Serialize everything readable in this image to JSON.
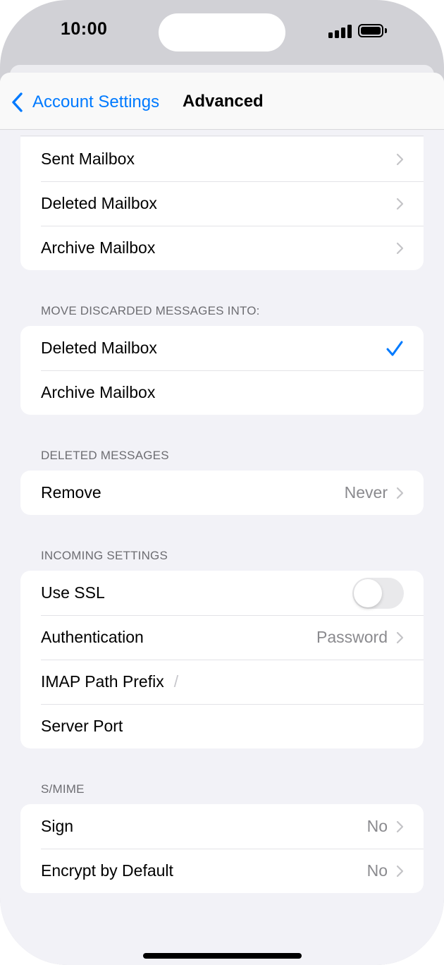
{
  "status_bar": {
    "time": "10:00"
  },
  "nav": {
    "back_label": "Account Settings",
    "title": "Advanced"
  },
  "mailbox_group": [
    {
      "label": "Sent Mailbox"
    },
    {
      "label": "Deleted Mailbox"
    },
    {
      "label": "Archive Mailbox"
    }
  ],
  "discard": {
    "header": "MOVE DISCARDED MESSAGES INTO:",
    "options": [
      {
        "label": "Deleted Mailbox",
        "selected": true
      },
      {
        "label": "Archive Mailbox",
        "selected": false
      }
    ]
  },
  "deleted_messages": {
    "header": "DELETED MESSAGES",
    "remove": {
      "label": "Remove",
      "value": "Never"
    }
  },
  "incoming": {
    "header": "INCOMING SETTINGS",
    "use_ssl": {
      "label": "Use SSL",
      "on": false
    },
    "authentication": {
      "label": "Authentication",
      "value": "Password"
    },
    "imap_prefix": {
      "label": "IMAP Path Prefix",
      "value": "/"
    },
    "server_port": {
      "label": "Server Port",
      "value": ""
    }
  },
  "smime": {
    "header": "S/MIME",
    "sign": {
      "label": "Sign",
      "value": "No"
    },
    "encrypt": {
      "label": "Encrypt by Default",
      "value": "No"
    }
  },
  "colors": {
    "accent": "#007aff",
    "background": "#f2f2f7",
    "secondary_text": "#8a8a8e"
  }
}
